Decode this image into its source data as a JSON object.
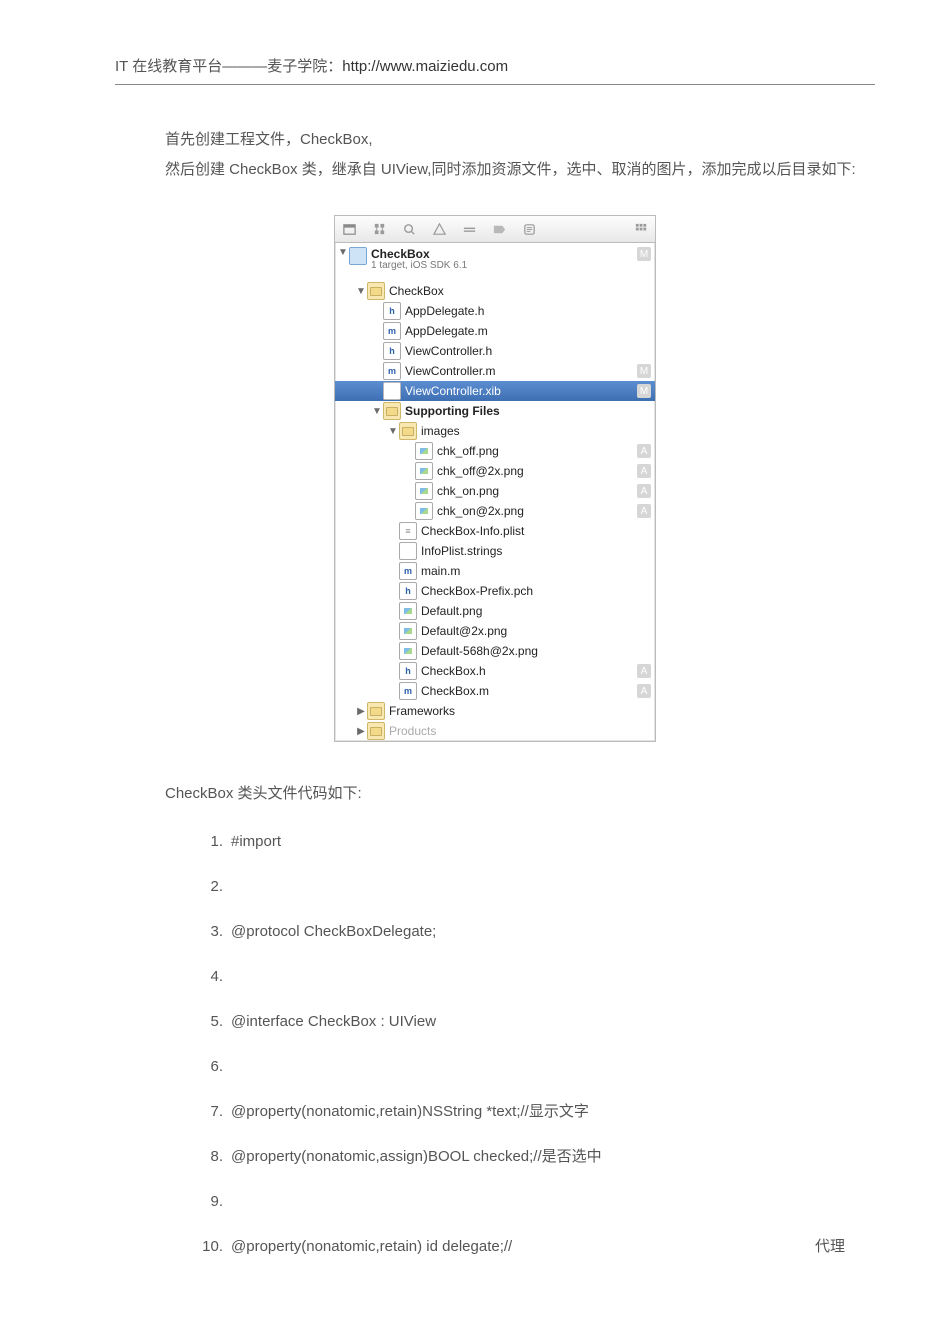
{
  "header": {
    "prefix": "IT 在线教育平台———麦子学院：",
    "url": "http://www.maiziedu.com"
  },
  "paragraphs": {
    "p1": "首先创建工程文件，CheckBox,",
    "p2": "然后创建 CheckBox 类，继承自 UIView,同时添加资源文件，选中、取消的图片，添加完成以后目录如下:"
  },
  "xcode": {
    "project": {
      "name": "CheckBox",
      "subtitle": "1 target, iOS SDK 6.1",
      "badge": "M"
    },
    "tree": [
      {
        "indent": 1,
        "disclosure": "open",
        "icon": "folder",
        "label": "CheckBox",
        "name": "folder-checkbox"
      },
      {
        "indent": 2,
        "icon": "h",
        "iconText": "h",
        "label": "AppDelegate.h",
        "name": "file-appdelegate-h"
      },
      {
        "indent": 2,
        "icon": "m",
        "iconText": "m",
        "label": "AppDelegate.m",
        "name": "file-appdelegate-m"
      },
      {
        "indent": 2,
        "icon": "h",
        "iconText": "h",
        "label": "ViewController.h",
        "name": "file-viewcontroller-h"
      },
      {
        "indent": 2,
        "icon": "m",
        "iconText": "m",
        "label": "ViewController.m",
        "name": "file-viewcontroller-m",
        "badge": "M"
      },
      {
        "indent": 2,
        "icon": "xib",
        "iconText": "",
        "label": "ViewController.xib",
        "name": "file-viewcontroller-xib",
        "selected": true,
        "badge": "M"
      },
      {
        "indent": 2,
        "disclosure": "open",
        "icon": "folder",
        "label": "Supporting Files",
        "bold": true,
        "name": "folder-supporting-files"
      },
      {
        "indent": 3,
        "disclosure": "open",
        "icon": "folder",
        "label": "images",
        "name": "folder-images"
      },
      {
        "indent": 4,
        "icon": "img",
        "label": "chk_off.png",
        "name": "file-chk-off",
        "badge": "A"
      },
      {
        "indent": 4,
        "icon": "img",
        "label": "chk_off@2x.png",
        "name": "file-chk-off-2x",
        "badge": "A"
      },
      {
        "indent": 4,
        "icon": "img",
        "label": "chk_on.png",
        "name": "file-chk-on",
        "badge": "A"
      },
      {
        "indent": 4,
        "icon": "img",
        "label": "chk_on@2x.png",
        "name": "file-chk-on-2x",
        "badge": "A"
      },
      {
        "indent": 3,
        "icon": "plist",
        "label": "CheckBox-Info.plist",
        "name": "file-info-plist"
      },
      {
        "indent": 3,
        "icon": "strings",
        "iconText": "",
        "label": "InfoPlist.strings",
        "name": "file-infoplist-strings"
      },
      {
        "indent": 3,
        "icon": "m",
        "iconText": "m",
        "label": "main.m",
        "name": "file-main-m"
      },
      {
        "indent": 3,
        "icon": "pch",
        "iconText": "h",
        "label": "CheckBox-Prefix.pch",
        "name": "file-prefix-pch"
      },
      {
        "indent": 3,
        "icon": "img",
        "label": "Default.png",
        "name": "file-default"
      },
      {
        "indent": 3,
        "icon": "img",
        "label": "Default@2x.png",
        "name": "file-default-2x"
      },
      {
        "indent": 3,
        "icon": "img",
        "label": "Default-568h@2x.png",
        "name": "file-default-568h"
      },
      {
        "indent": 3,
        "icon": "h",
        "iconText": "h",
        "label": "CheckBox.h",
        "name": "file-checkbox-h",
        "badge": "A"
      },
      {
        "indent": 3,
        "icon": "m",
        "iconText": "m",
        "label": "CheckBox.m",
        "name": "file-checkbox-m",
        "badge": "A"
      },
      {
        "indent": 1,
        "disclosure": "closed",
        "icon": "folder",
        "label": "Frameworks",
        "name": "folder-frameworks"
      },
      {
        "indent": 1,
        "disclosure": "closed",
        "icon": "folder",
        "label": "Products",
        "name": "folder-products",
        "dim": true
      }
    ]
  },
  "section2": "CheckBox 类头文件代码如下:",
  "code": [
    {
      "n": "1.",
      "t": "#import"
    },
    {
      "n": "2.",
      "t": ""
    },
    {
      "n": "3.",
      "t": "@protocol CheckBoxDelegate;"
    },
    {
      "n": "4.",
      "t": ""
    },
    {
      "n": "5.",
      "t": "@interface CheckBox : UIView"
    },
    {
      "n": "6.",
      "t": ""
    },
    {
      "n": "7.",
      "t": "@property(nonatomic,retain)NSString *text;//显示文字"
    },
    {
      "n": "8.",
      "t": "@property(nonatomic,assign)BOOL checked;//是否选中"
    },
    {
      "n": "9.",
      "t": ""
    },
    {
      "n": "10.",
      "t": "@property(nonatomic,retain) id delegate;//",
      "right": "代理"
    }
  ]
}
